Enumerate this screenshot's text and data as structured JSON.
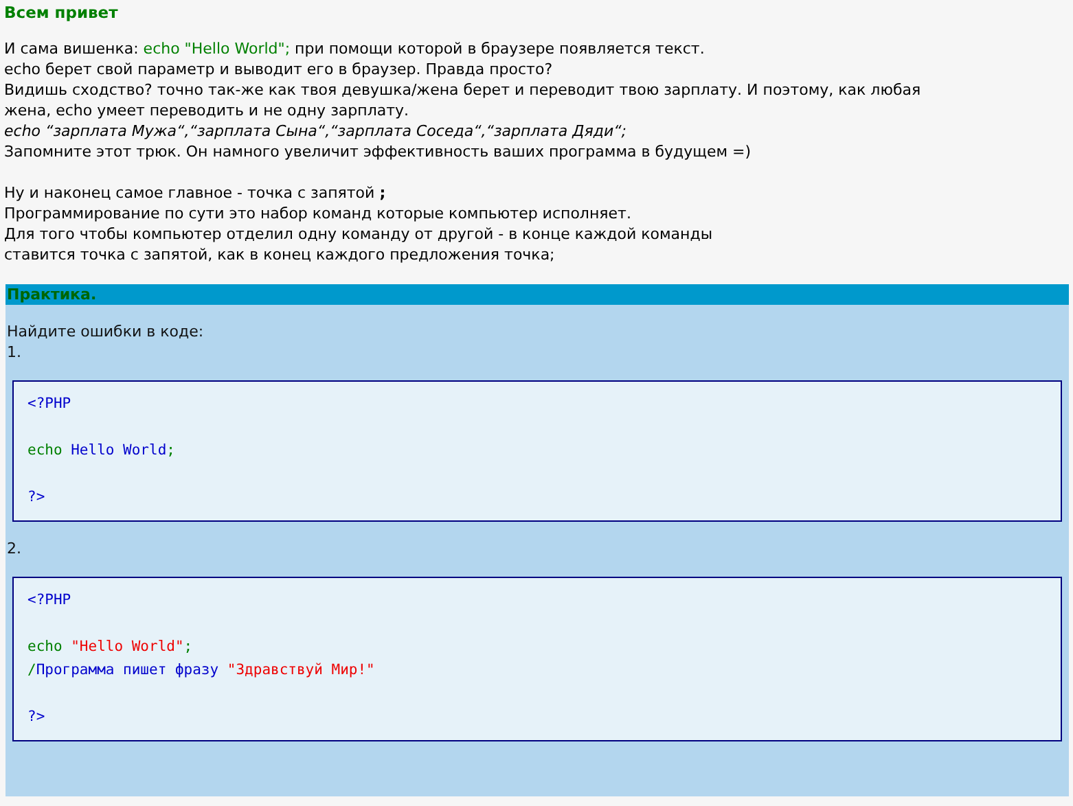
{
  "heading": "Всем привет",
  "paragraphs": [
    [
      {
        "kind": "plain",
        "parts": [
          {
            "kind": "text",
            "text": "И сама вишенка: "
          },
          {
            "kind": "code",
            "text": "echo \"Hello World\";"
          },
          {
            "kind": "text",
            "text": " при помощи которой в браузере появляется текст."
          }
        ]
      },
      {
        "kind": "plain",
        "parts": [
          {
            "kind": "text",
            "text": "echo берет свой параметр и выводит его в браузер. Правда просто?"
          }
        ]
      },
      {
        "kind": "plain",
        "parts": [
          {
            "kind": "text",
            "text": "Видишь сходство? точно так-же как твоя девушка/жена берет и переводит твою зарплату. И поэтому, как любая"
          }
        ]
      },
      {
        "kind": "plain",
        "parts": [
          {
            "kind": "text",
            "text": "жена, echo умеет переводить и не одну зарплату."
          }
        ]
      },
      {
        "kind": "italic",
        "parts": [
          {
            "kind": "text",
            "text": "echo “зарплата Мужа“,“зарплата Сына“,“зарплата Соседа“,“зарплата Дяди“;"
          }
        ]
      },
      {
        "kind": "plain",
        "parts": [
          {
            "kind": "text",
            "text": "Запомните этот трюк. Он намного увеличит эффективность ваших программа в будущем =)"
          }
        ]
      }
    ],
    [
      {
        "kind": "plain",
        "parts": [
          {
            "kind": "text",
            "text": "Ну и наконец самое главное - точка с запятой **;**"
          }
        ]
      },
      {
        "kind": "plain",
        "parts": [
          {
            "kind": "text",
            "text": "Программирование по сути это набор команд которые компьютер исполняет."
          }
        ]
      },
      {
        "kind": "plain",
        "parts": [
          {
            "kind": "text",
            "text": "Для того чтобы компьютер отделил одну команду от другой - в конце каждой команды"
          }
        ]
      },
      {
        "kind": "plain",
        "parts": [
          {
            "kind": "text",
            "text": "ставится точка с запятой, как в конец каждого предложения точка;"
          }
        ]
      }
    ]
  ],
  "practice": {
    "title": "Практика.",
    "prompt": "Найдите ошибки в коде:",
    "exercises": [
      {
        "number": "1.",
        "blocks": [
          [
            [
              {
                "kind": "text",
                "text": "<?PHP"
              }
            ]
          ],
          [
            [
              {
                "kind": "keyword",
                "text": "echo "
              },
              {
                "kind": "text",
                "text": "Hello World"
              },
              {
                "kind": "keyword",
                "text": ";"
              }
            ]
          ],
          [
            [
              {
                "kind": "text",
                "text": "?>"
              }
            ]
          ]
        ]
      },
      {
        "number": "2.",
        "blocks": [
          [
            [
              {
                "kind": "text",
                "text": "<?PHP"
              }
            ]
          ],
          [
            [
              {
                "kind": "keyword",
                "text": "echo "
              },
              {
                "kind": "string",
                "text": "\"Hello World\""
              },
              {
                "kind": "keyword",
                "text": ";"
              }
            ],
            [
              {
                "kind": "keyword",
                "text": "/"
              },
              {
                "kind": "text",
                "text": "Программа пишет фразу "
              },
              {
                "kind": "string",
                "text": "\"Здравствуй Мир!\""
              }
            ]
          ],
          [
            [
              {
                "kind": "text",
                "text": "?>"
              }
            ]
          ]
        ]
      }
    ]
  }
}
